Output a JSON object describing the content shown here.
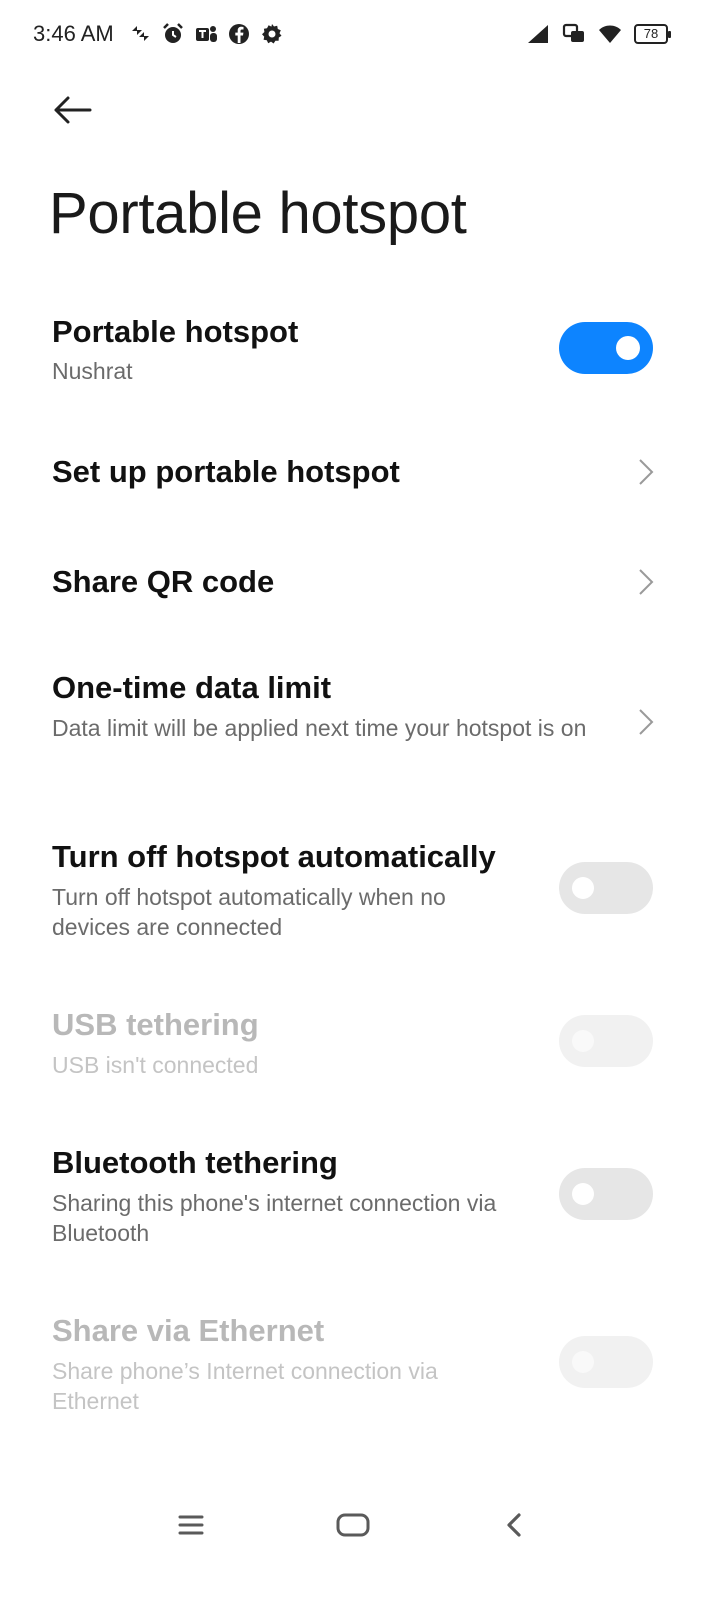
{
  "status_bar": {
    "time": "3:46 AM",
    "left_icons": [
      "data-saver-icon",
      "alarm-icon",
      "teams-icon",
      "facebook-icon",
      "settings-gear-icon"
    ],
    "right_icons": [
      "cellular-signal-icon",
      "dual-sim-icon",
      "wifi-icon"
    ],
    "battery": "78"
  },
  "header": {
    "back_icon": "arrow-left-icon",
    "title": "Portable hotspot"
  },
  "settings": {
    "hotspot": {
      "title": "Portable hotspot",
      "subtitle": "Nushrat",
      "enabled": true
    },
    "setup": {
      "title": "Set up portable hotspot"
    },
    "share_qr": {
      "title": "Share QR code"
    },
    "data_limit": {
      "title": "One-time data limit",
      "subtitle": "Data limit will be applied next time your hotspot is on"
    },
    "auto_off": {
      "title": "Turn off hotspot automatically",
      "subtitle": "Turn off hotspot automatically when no devices are connected",
      "enabled": false
    },
    "usb": {
      "title": "USB tethering",
      "subtitle": "USB isn't connected",
      "enabled": false,
      "disabled": true
    },
    "bluetooth": {
      "title": "Bluetooth tethering",
      "subtitle": "Sharing this phone's internet connection via Bluetooth",
      "enabled": false
    },
    "ethernet": {
      "title": "Share via Ethernet",
      "subtitle": "Share phone’s Internet connection via Ethernet",
      "enabled": false,
      "disabled": true
    }
  },
  "nav_bar": {
    "icons": [
      "menu-icon",
      "home-icon",
      "back-icon"
    ]
  },
  "colors": {
    "accent": "#0d84ff",
    "toggle_off": "#e6e6e6",
    "subtitle": "#6b6b6b",
    "disabled_text": "#b8b8b8"
  }
}
